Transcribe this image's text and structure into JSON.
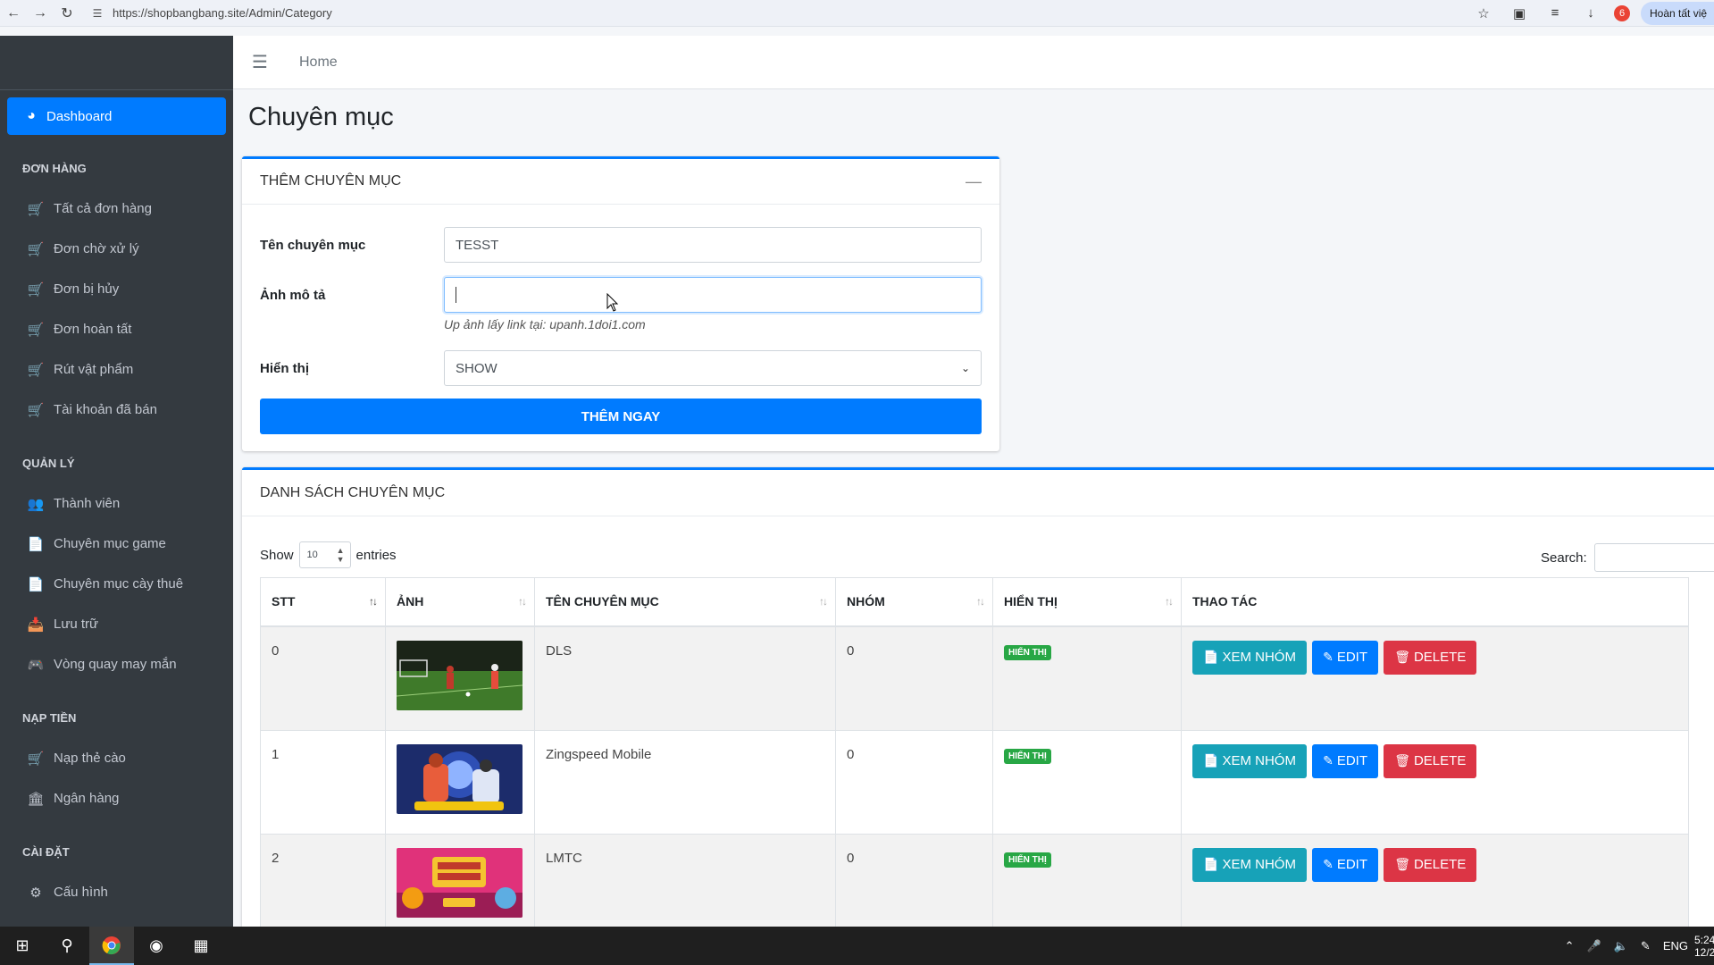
{
  "browser": {
    "url": "https://shopbangbang.site/Admin/Category",
    "notification_count": "6",
    "profile_label": "Hoàn tất việ"
  },
  "sidebar": {
    "dashboard": "Dashboard",
    "sections": [
      {
        "header": "ĐƠN HÀNG",
        "items": [
          "Tất cả đơn hàng",
          "Đơn chờ xử lý",
          "Đơn bị hủy",
          "Đơn hoàn tất",
          "Rút vật phẩm",
          "Tài khoản đã bán"
        ]
      },
      {
        "header": "QUẢN LÝ",
        "items": [
          "Thành viên",
          "Chuyên mục game",
          "Chuyên mục cày thuê",
          "Lưu trữ",
          "Vòng quay may mắn"
        ]
      },
      {
        "header": "NẠP TIỀN",
        "items": [
          "Nạp thẻ cào",
          "Ngân hàng"
        ]
      },
      {
        "header": "CÀI ĐẶT",
        "items": [
          "Cấu hình"
        ]
      }
    ]
  },
  "topnav": {
    "home": "Home"
  },
  "page": {
    "title": "Chuyên mục"
  },
  "add_form": {
    "title": "THÊM CHUYÊN MỤC",
    "name_label": "Tên chuyên mục",
    "name_value": "TESST",
    "image_label": "Ảnh mô tả",
    "image_value": "",
    "image_hint": "Up ảnh lấy link tại: upanh.1doi1.com",
    "display_label": "Hiển thị",
    "display_value": "SHOW",
    "submit": "THÊM NGAY"
  },
  "list": {
    "title": "DANH SÁCH CHUYÊN MỤC",
    "show_label": "Show",
    "entries_value": "10",
    "entries_label": "entries",
    "search_label": "Search:",
    "columns": [
      "STT",
      "ẢNH",
      "TÊN CHUYÊN MỤC",
      "NHÓM",
      "HIỂN THỊ",
      "THAO TÁC"
    ],
    "rows": [
      {
        "stt": "0",
        "name": "DLS",
        "group": "0",
        "status": "HIỂN THỊ"
      },
      {
        "stt": "1",
        "name": "Zingspeed Mobile",
        "group": "0",
        "status": "HIỂN THỊ"
      },
      {
        "stt": "2",
        "name": "LMTC",
        "group": "0",
        "status": "HIỂN THỊ"
      }
    ],
    "actions": {
      "view": "XEM NHÓM",
      "edit": "EDIT",
      "delete": "DELETE"
    }
  },
  "taskbar": {
    "lang": "ENG",
    "time": "5:24",
    "date": "12/2"
  }
}
